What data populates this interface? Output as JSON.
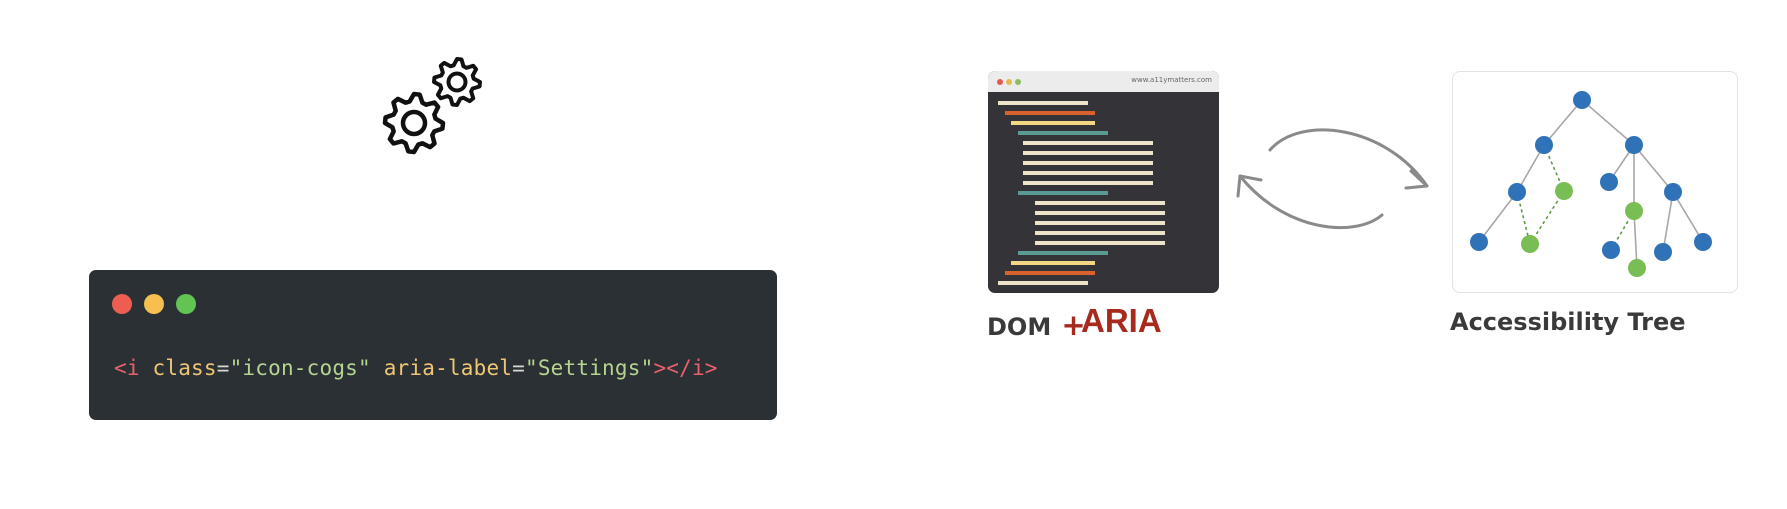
{
  "code_block": {
    "open_tag": "<i",
    "attr1_name": " class",
    "eq1": "=",
    "attr1_value": "\"icon-cogs\"",
    "attr2_name": " aria-label",
    "eq2": "=",
    "attr2_value": "\"Settings\"",
    "close_tag": "></i>"
  },
  "dom_panel": {
    "url": "www.a11ymatters.com",
    "label_dom": "DOM",
    "label_plus": " +",
    "label_aria": "ARIA"
  },
  "tree_panel": {
    "label": "Accessibility Tree"
  },
  "colors": {
    "tag": "#e8616a",
    "attr_name": "#f0c674",
    "attr_value": "#b5d48f",
    "punct": "#d7d9d0",
    "aria_red": "#a82a1d",
    "node_blue": "#2f72b8",
    "node_green": "#79bd55"
  },
  "icons": [
    "cogs-icon",
    "bidirectional-arrow-icon"
  ]
}
